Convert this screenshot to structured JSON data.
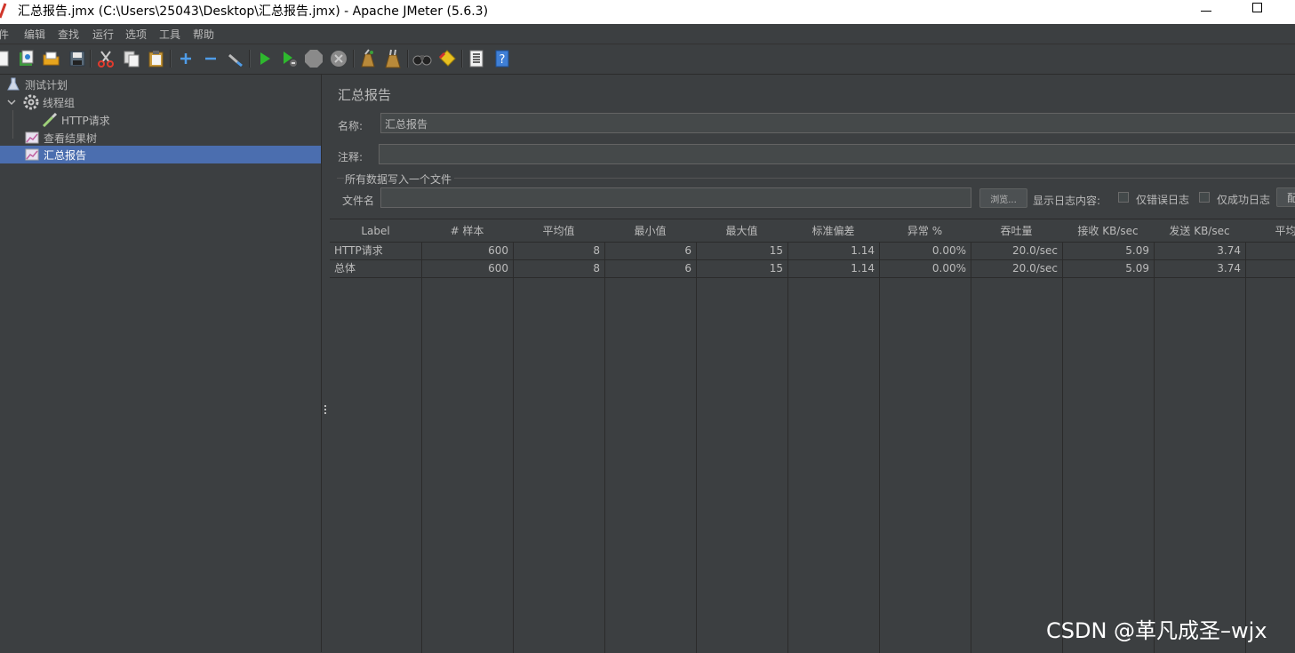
{
  "window": {
    "title": "汇总报告.jmx (C:\\Users\\25043\\Desktop\\汇总报告.jmx) - Apache JMeter (5.6.3)"
  },
  "menu": [
    "件",
    "编辑",
    "查找",
    "运行",
    "选项",
    "工具",
    "帮助"
  ],
  "toolbar_icons": [
    "new-icon",
    "templates-icon",
    "open-icon",
    "save-icon",
    "cut-icon",
    "copy-icon",
    "paste-icon",
    "expand-icon",
    "collapse-icon",
    "toggle-icon",
    "start-icon",
    "start-no-pause-icon",
    "stop-icon",
    "shutdown-icon",
    "clear-icon",
    "clear-all-icon",
    "search-icon",
    "reset-search-icon",
    "function-helper-icon",
    "help-icon"
  ],
  "tree": {
    "test_plan": "测试计划",
    "thread_group": "线程组",
    "http_request": "HTTP请求",
    "view_results_tree": "查看结果树",
    "summary_report": "汇总报告"
  },
  "panel": {
    "title": "汇总报告",
    "name_label": "名称:",
    "name_value": "汇总报告",
    "comment_label": "注释:",
    "comment_value": "",
    "file_group_label": "所有数据写入一个文件",
    "filename_label": "文件名",
    "filename_value": "",
    "browse_label": "浏览...",
    "log_content_label": "显示日志内容:",
    "errors_only_label": "仅错误日志",
    "success_only_label": "仅成功日志",
    "configure_label": "配"
  },
  "table": {
    "headers": [
      "Label",
      "# 样本",
      "平均值",
      "最小值",
      "最大值",
      "标准偏差",
      "异常 %",
      "吞吐量",
      "接收 KB/sec",
      "发送 KB/sec",
      "平均字"
    ],
    "rows": [
      [
        "HTTP请求",
        "600",
        "8",
        "6",
        "15",
        "1.14",
        "0.00%",
        "20.0/sec",
        "5.09",
        "3.74",
        ""
      ],
      [
        "总体",
        "600",
        "8",
        "6",
        "15",
        "1.14",
        "0.00%",
        "20.0/sec",
        "5.09",
        "3.74",
        ""
      ]
    ]
  },
  "watermark": "CSDN @革凡成圣–wjx"
}
